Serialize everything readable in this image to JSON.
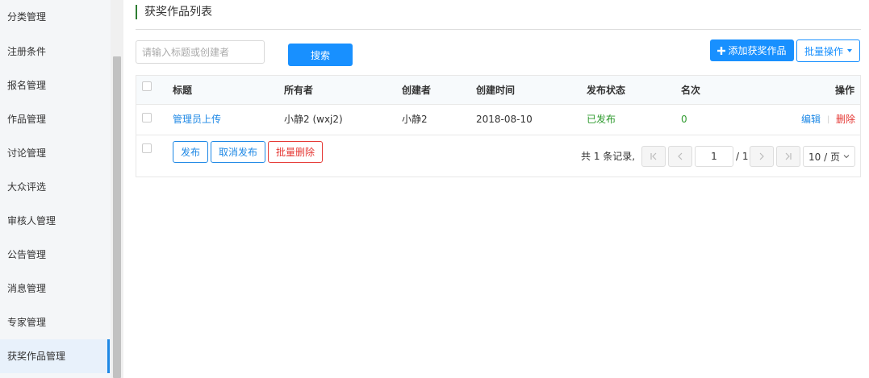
{
  "sidebar": {
    "items": [
      {
        "label": "分类管理"
      },
      {
        "label": "注册条件"
      },
      {
        "label": "报名管理"
      },
      {
        "label": "作品管理"
      },
      {
        "label": "讨论管理"
      },
      {
        "label": "大众评选"
      },
      {
        "label": "审核人管理"
      },
      {
        "label": "公告管理"
      },
      {
        "label": "消息管理"
      },
      {
        "label": "专家管理"
      },
      {
        "label": "获奖作品管理",
        "active": true
      }
    ]
  },
  "page": {
    "title": "获奖作品列表"
  },
  "search": {
    "placeholder": "请输入标题或创建者",
    "value": "",
    "button_label": "搜索"
  },
  "toolbar": {
    "add_label": "添加获奖作品",
    "add_icon": "plus-icon",
    "batch_label": "批量操作"
  },
  "table": {
    "headers": {
      "title": "标题",
      "owner": "所有者",
      "creator": "创建者",
      "created_time": "创建时间",
      "status": "发布状态",
      "rank": "名次",
      "actions": "操作"
    },
    "rows": [
      {
        "title": "管理员上传",
        "owner": "小静2 (wxj2)",
        "creator": "小静2",
        "created_time": "2018-08-10",
        "status": "已发布",
        "rank": "0",
        "edit_label": "编辑",
        "delete_label": "删除"
      }
    ],
    "separator": "|"
  },
  "footer": {
    "publish_label": "发布",
    "unpublish_label": "取消发布",
    "batch_delete_label": "批量删除"
  },
  "pagination": {
    "total_text": "共 1 条记录,",
    "current_page": "1",
    "total_pages_text": "/ 1",
    "page_size_text": "10 / 页"
  },
  "colors": {
    "primary": "#1890ff",
    "link": "#1e88e5",
    "success": "#2e9a2e",
    "danger": "#e53935",
    "title_accent": "#2e7d32"
  }
}
